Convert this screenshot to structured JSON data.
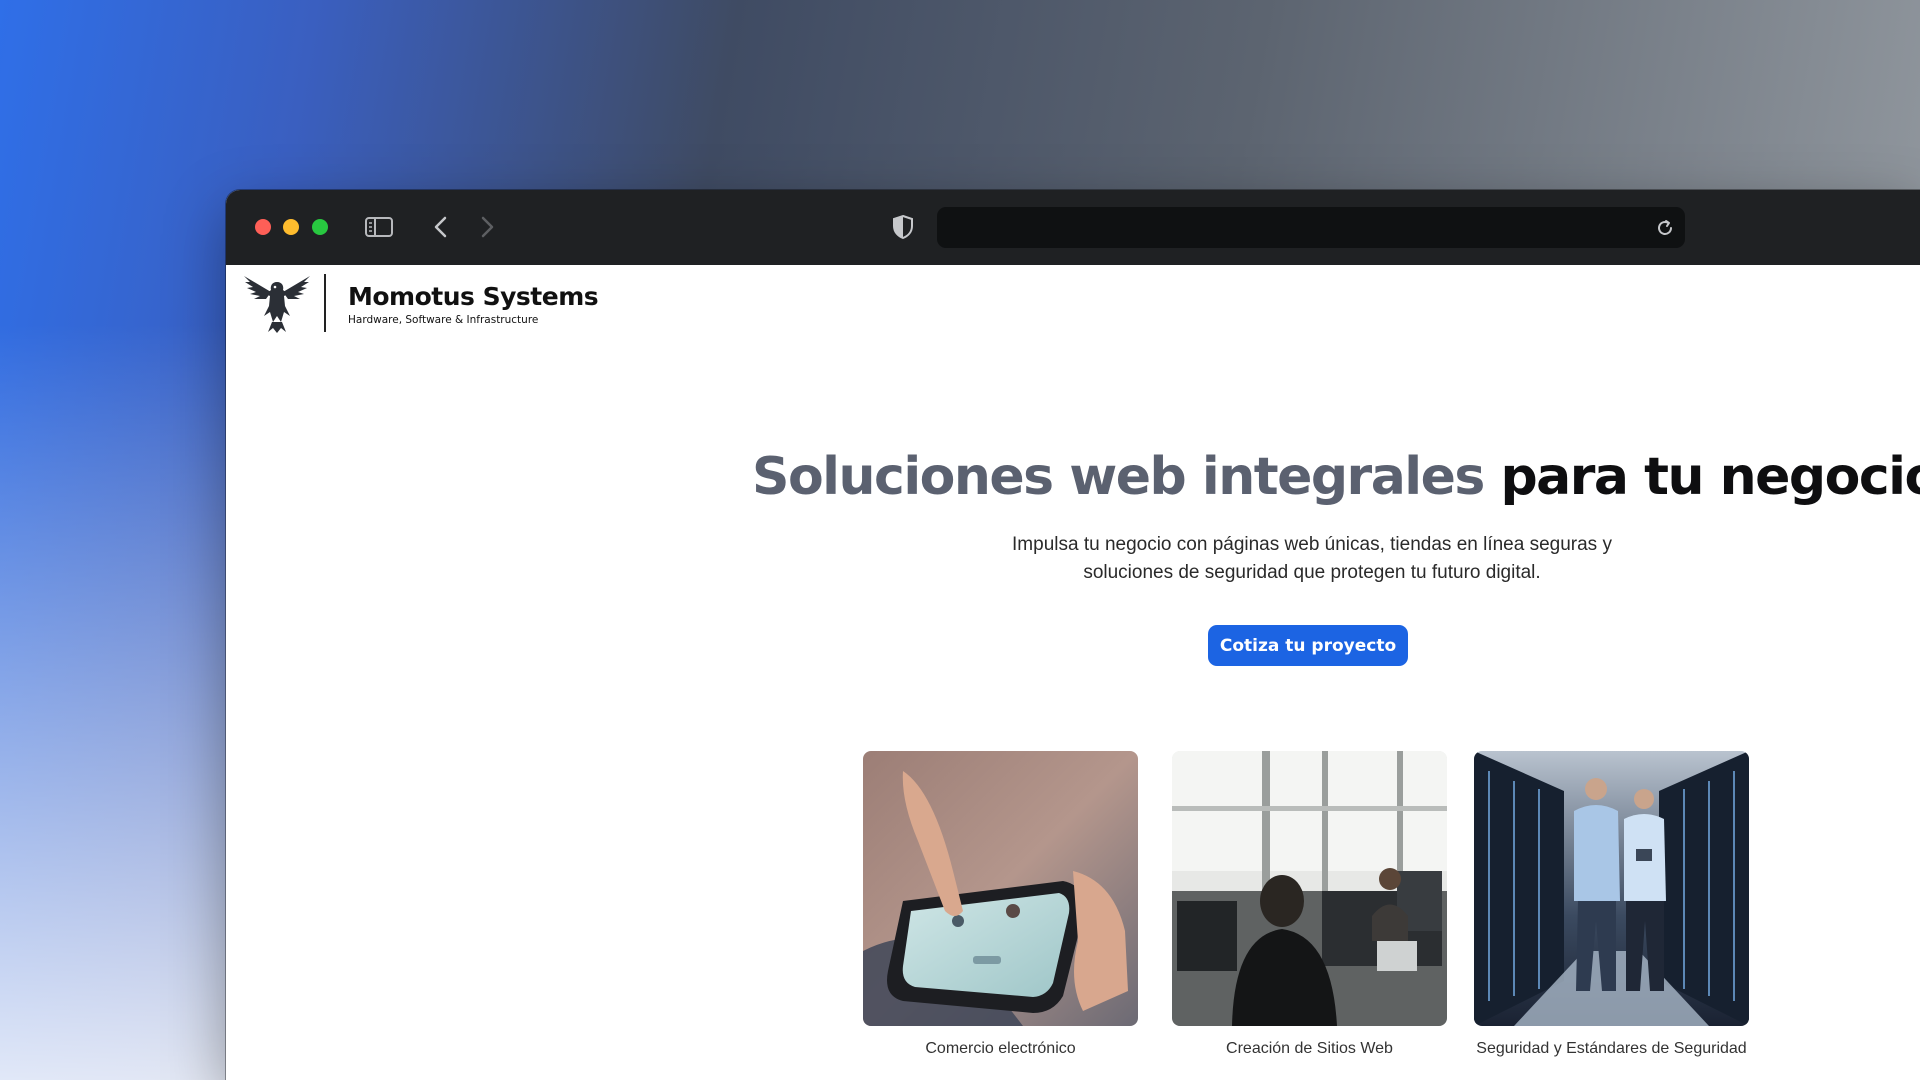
{
  "browser": {
    "address_url": "",
    "icons": [
      "sidebar-icon",
      "back-icon",
      "forward-icon",
      "shield-icon",
      "reload-icon"
    ]
  },
  "brand": {
    "name": "Momotus Systems",
    "tagline": "Hardware, Software & Infrastructure"
  },
  "hero": {
    "title_muted": "Soluciones web integrales",
    "title_strong": "para tu negocio.",
    "subtitle_line1": "Impulsa tu negocio con páginas web únicas, tiendas en línea seguras y",
    "subtitle_line2": "soluciones de seguridad que protegen tu futuro digital.",
    "cta_label": "Cotiza tu proyecto"
  },
  "services": [
    {
      "label": "Comercio electrónico"
    },
    {
      "label": "Creación de Sitios Web"
    },
    {
      "label": "Seguridad y Estándares de Seguridad"
    }
  ],
  "colors": {
    "accent": "#1c64e3",
    "title_muted": "#5b6170",
    "toolbar": "#1f2123"
  }
}
